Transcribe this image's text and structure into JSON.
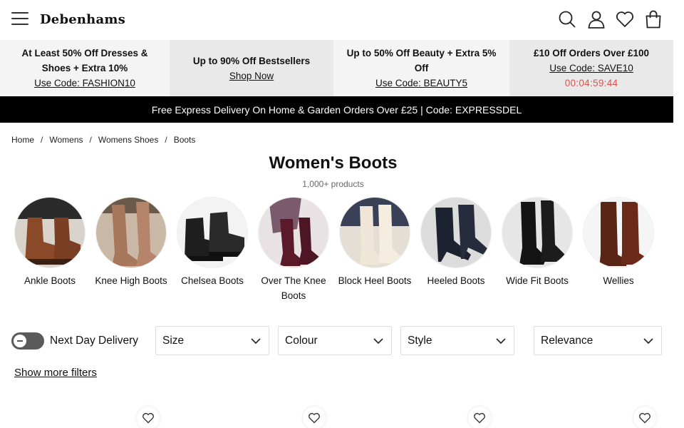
{
  "header": {
    "logo": "Debenhams",
    "icons": [
      "menu-icon",
      "search-icon",
      "account-icon",
      "wishlist-icon",
      "bag-icon"
    ]
  },
  "promos": [
    {
      "title": "At Least 50% Off Dresses & Shoes + Extra 10%",
      "link": "Use Code: FASHION10"
    },
    {
      "title": "Up to 90% Off Bestsellers",
      "link": "Shop Now"
    },
    {
      "title": "Up to 50% Off Beauty + Extra 5% Off",
      "link": "Use Code: BEAUTY5"
    },
    {
      "title": "£10 Off Orders Over £100",
      "link": "Use Code: SAVE10",
      "countdown": "00:04:59:44"
    }
  ],
  "delivery_banner": "Free Express Delivery On Home & Garden Orders Over £25 | Code: EXPRESSDEL",
  "breadcrumb": [
    "Home",
    "Womens",
    "Womens Shoes",
    "Boots"
  ],
  "page": {
    "title": "Women's Boots",
    "count": "1,000+ products"
  },
  "categories": [
    {
      "label": "Ankle Boots"
    },
    {
      "label": "Knee High Boots"
    },
    {
      "label": "Chelsea Boots"
    },
    {
      "label": "Over The Knee Boots"
    },
    {
      "label": "Block Heel Boots"
    },
    {
      "label": "Heeled Boots"
    },
    {
      "label": "Wide Fit Boots"
    },
    {
      "label": "Wellies"
    }
  ],
  "filters": {
    "next_day_label": "Next Day Delivery",
    "next_day_on": false,
    "size": "Size",
    "colour": "Colour",
    "style": "Style",
    "sort": "Relevance",
    "more": "Show more filters"
  },
  "colors": {
    "banner_bg": "#000000",
    "countdown": "#d9534f",
    "promo_light": "#f4f4f4",
    "promo_dark": "#e9e9e9"
  }
}
